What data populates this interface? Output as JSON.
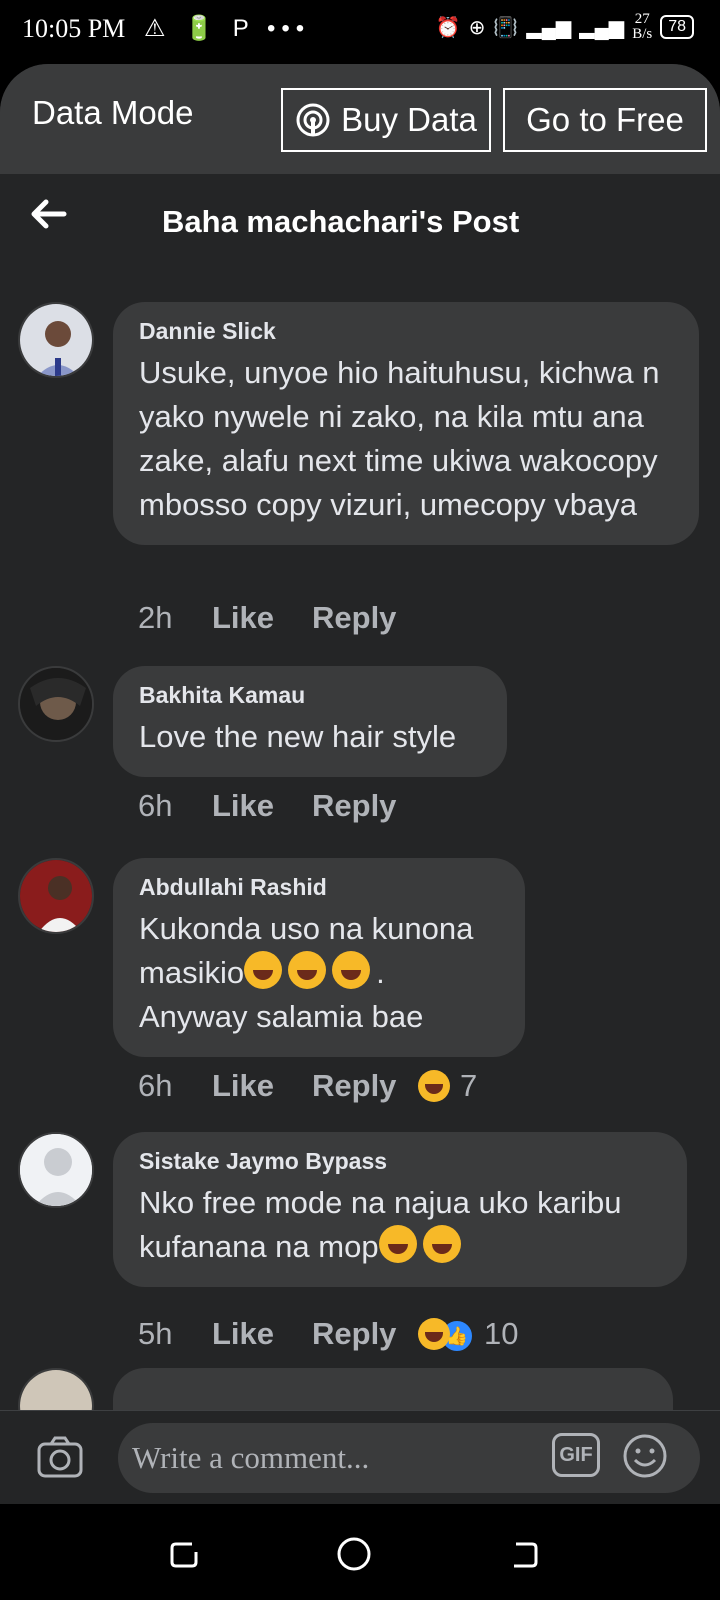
{
  "status_bar": {
    "time": "10:05 PM",
    "left_icons": "⚠ 🔋 P •••",
    "speed_value": "27",
    "speed_unit": "B/s",
    "battery": "78"
  },
  "data_mode": {
    "label": "Data Mode",
    "buy_label": "Buy Data",
    "free_label": "Go to Free"
  },
  "header": {
    "back_icon": "arrow-left",
    "title": "Baha machachari's Post"
  },
  "comments": [
    {
      "name": "Dannie Slick",
      "text": "Usuke, unyoe hio haituhusu, kichwa n yako nywele ni zako, na kila mtu ana zake, alafu next time ukiwa wakocopy mbosso copy vizuri, umecopy vbaya",
      "time": "2h",
      "like": "Like",
      "reply": "Reply"
    },
    {
      "name": "Bakhita Kamau",
      "text": "Love the new hair style",
      "time": "6h",
      "like": "Like",
      "reply": "Reply"
    },
    {
      "name": "Abdullahi Rashid",
      "text_line1": "Kukonda uso na kunona",
      "text_line2": "masikio",
      "text_line2_suffix": ".",
      "text_line3": "Anyway salamia bae",
      "time": "6h",
      "like": "Like",
      "reply": "Reply",
      "reaction_count": "7"
    },
    {
      "name": "Sistake Jaymo Bypass",
      "text_line1": "Nko free mode na najua uko karibu",
      "text_line2": "kufanana na mop",
      "time": "5h",
      "like": "Like",
      "reply": "Reply",
      "reaction_count": "10"
    }
  ],
  "composer": {
    "placeholder": "Write a comment...",
    "gif_label": "GIF"
  },
  "colors": {
    "app_bg": "#242526",
    "bubble_bg": "#3a3b3c",
    "data_mode_bg": "#3a3b3c",
    "text": "#e4e6eb",
    "muted": "#b0b3b8",
    "like_blue": "#2d88ff",
    "emoji_yellow": "#f7b928"
  }
}
